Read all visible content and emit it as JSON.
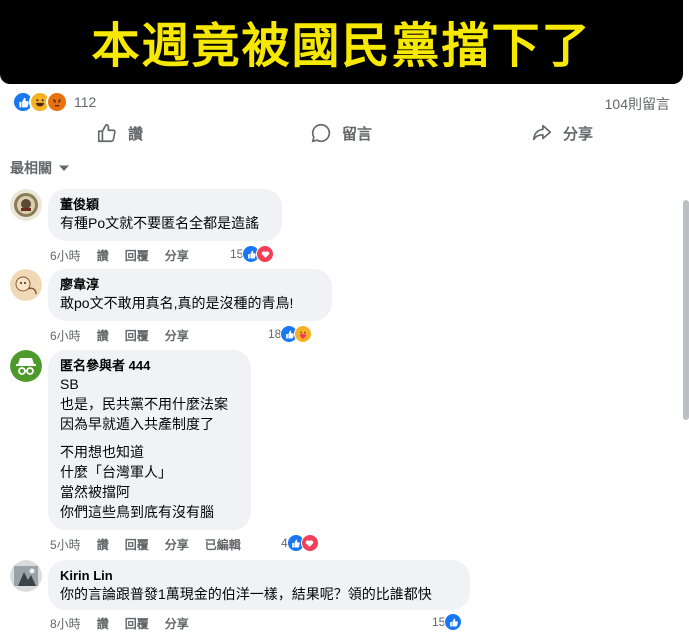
{
  "banner": {
    "headline": "本週竟被國民黨擋下了"
  },
  "post_stats": {
    "reaction_count": "112",
    "comment_count": "104則留言"
  },
  "actions": {
    "like": "讚",
    "comment": "留言",
    "share": "分享"
  },
  "sort": {
    "label": "最相關"
  },
  "comments": [
    {
      "author": "董俊穎",
      "text": "有種Po文就不要匿名全都是造謠",
      "time": "6小時",
      "like": "讚",
      "reply": "回覆",
      "share": "分享",
      "count": "15"
    },
    {
      "author": "廖韋淳",
      "text": "敢po文不敢用真名,真的是沒種的青鳥!",
      "time": "6小時",
      "like": "讚",
      "reply": "回覆",
      "share": "分享",
      "count": "18"
    },
    {
      "author": "匿名參與者 444",
      "text": "SB\n也是，民共黨不用什麼法案\n因為早就遁入共產制度了",
      "text2": "不用想也知道\n什麼「台灣軍人」\n當然被擋阿\n你們這些鳥到底有沒有腦",
      "time": "5小時",
      "like": "讚",
      "reply": "回覆",
      "share": "分享",
      "edited": "已編輯",
      "count": "4"
    },
    {
      "author": "Kirin Lin",
      "text": "你的言論跟普發1萬現金的伯洋一樣，結果呢？領的比誰都快",
      "time": "8小時",
      "like": "讚",
      "reply": "回覆",
      "share": "分享",
      "count": "15"
    }
  ],
  "colors": {
    "banner_text": "#f7e800",
    "facebook_blue": "#1877f2",
    "bubble": "#f0f2f5"
  }
}
